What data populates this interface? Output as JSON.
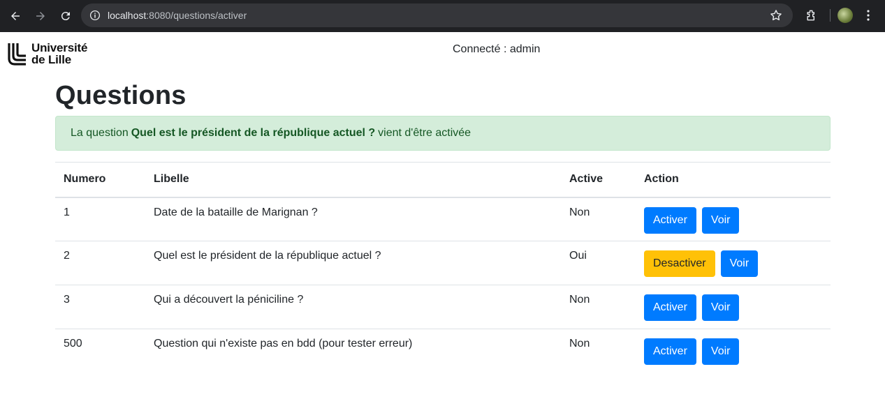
{
  "browser": {
    "url_host": "localhost",
    "url_path": ":8080/questions/activer"
  },
  "header": {
    "logo_line1": "Université",
    "logo_line2": "de Lille",
    "connected": "Connecté : admin"
  },
  "main": {
    "title": "Questions",
    "alert": {
      "prefix": "La question",
      "question": "Quel est le président de la république actuel ?",
      "suffix": "vient d'être activée"
    },
    "table": {
      "headers": [
        "Numero",
        "Libelle",
        "Active",
        "Action"
      ],
      "rows": [
        {
          "numero": "1",
          "libelle": "Date de la bataille de Marignan ?",
          "active": "Non",
          "action_label": "Activer",
          "view_label": "Voir"
        },
        {
          "numero": "2",
          "libelle": "Quel est le président de la république actuel ?",
          "active": "Oui",
          "action_label": "Desactiver",
          "view_label": "Voir"
        },
        {
          "numero": "3",
          "libelle": "Qui a découvert la péniciline ?",
          "active": "Non",
          "action_label": "Activer",
          "view_label": "Voir"
        },
        {
          "numero": "500",
          "libelle": "Question qui n'existe pas en bdd (pour tester erreur)",
          "active": "Non",
          "action_label": "Activer",
          "view_label": "Voir"
        }
      ]
    }
  },
  "colors": {
    "primary": "#007bff",
    "warning": "#ffc107",
    "alert_bg": "#d4edda",
    "alert_text": "#155724"
  }
}
